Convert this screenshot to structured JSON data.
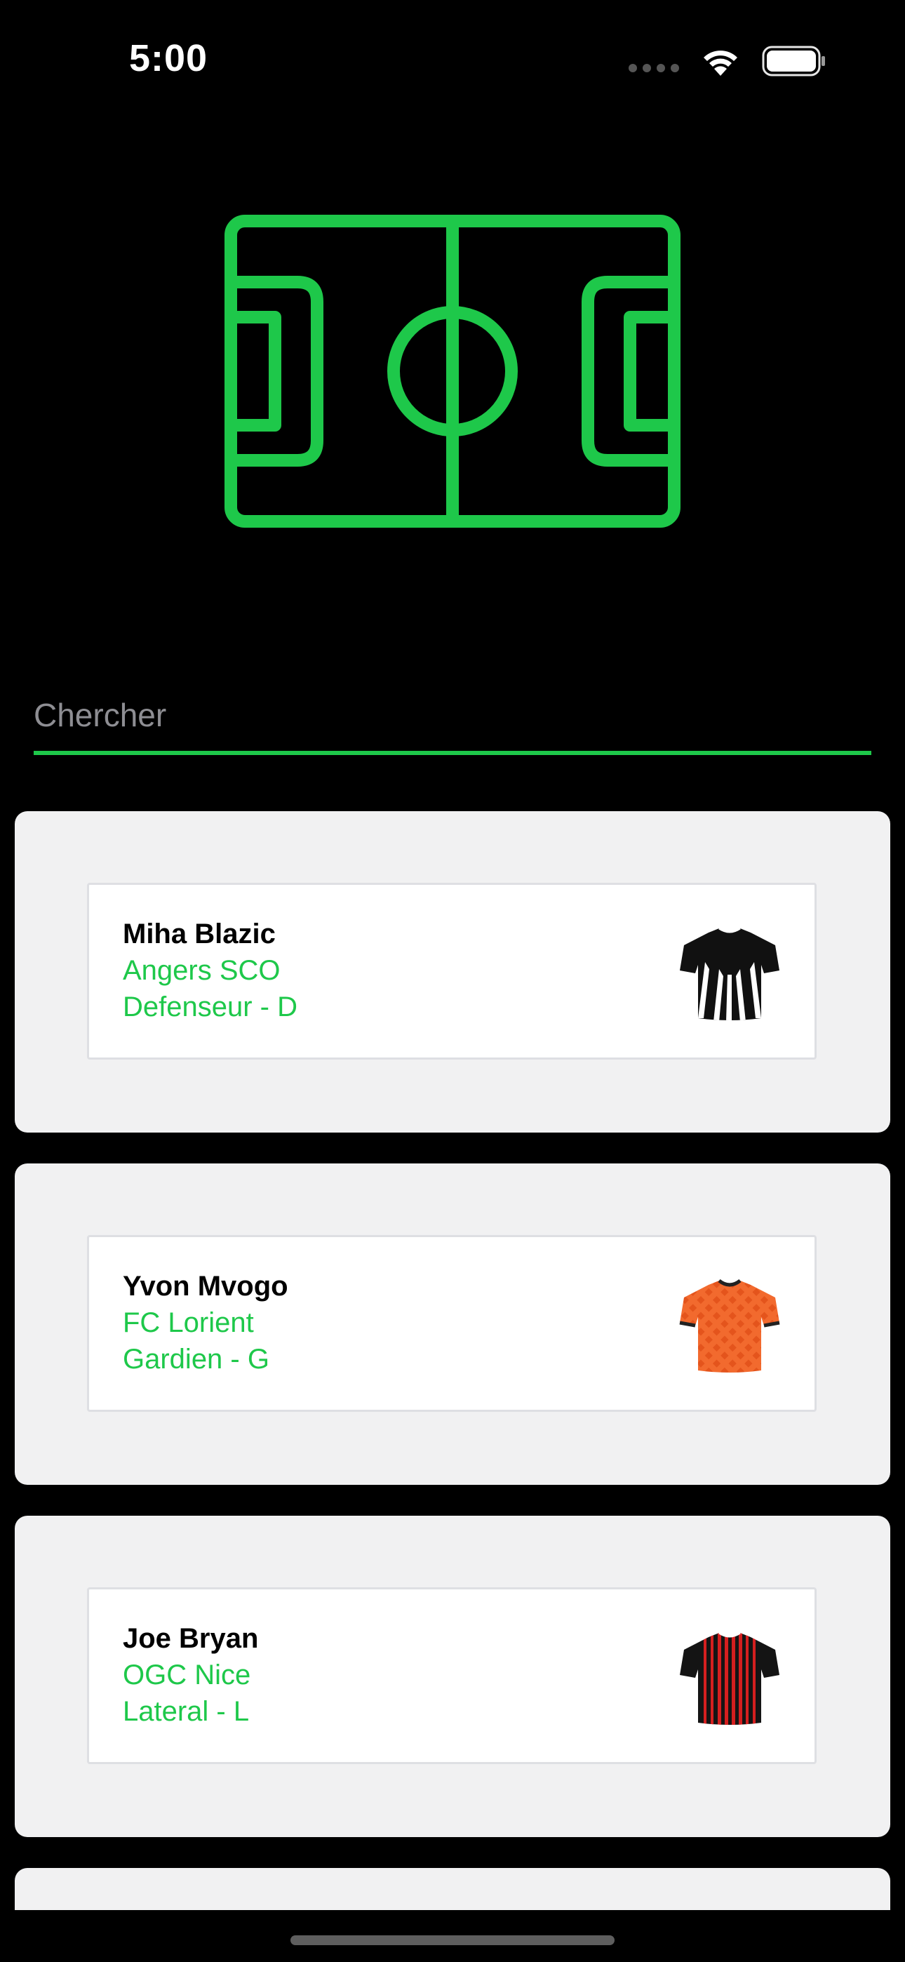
{
  "status_bar": {
    "time": "5:00"
  },
  "search": {
    "placeholder": "Chercher",
    "value": ""
  },
  "colors": {
    "accent": "#1ec84a",
    "background": "#000000",
    "card_bg": "#f1f1f2"
  },
  "players": [
    {
      "name": "Miha Blazic",
      "team": "Angers SCO",
      "position": "Defenseur - D",
      "jersey_icon": "angers-jersey-icon"
    },
    {
      "name": "Yvon Mvogo",
      "team": "FC Lorient",
      "position": "Gardien - G",
      "jersey_icon": "lorient-jersey-icon"
    },
    {
      "name": "Joe Bryan",
      "team": "OGC Nice",
      "position": "Lateral - L",
      "jersey_icon": "nice-jersey-icon"
    }
  ]
}
